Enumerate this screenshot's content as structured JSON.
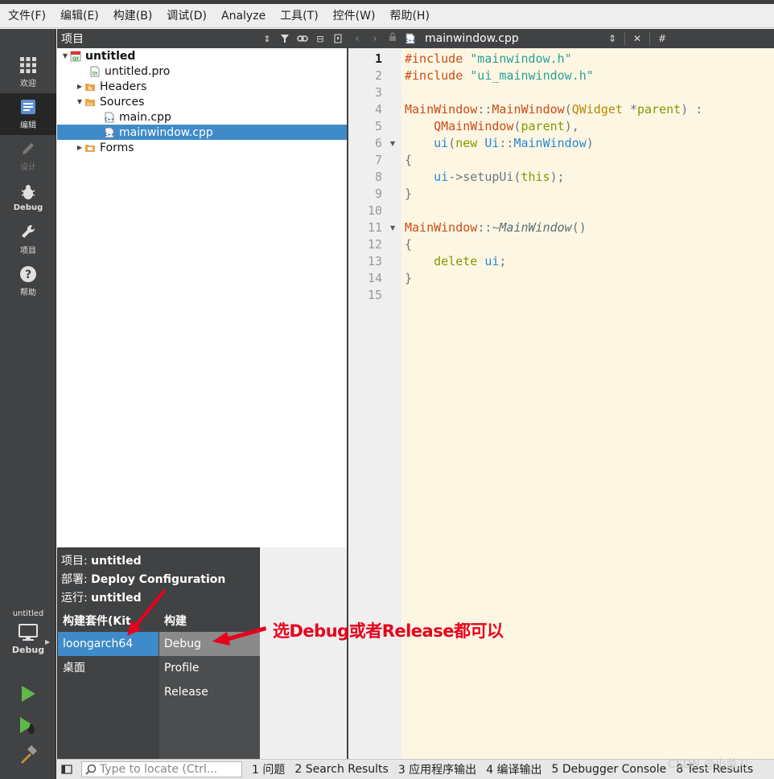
{
  "menubar": {
    "items": [
      "文件(F)",
      "编辑(E)",
      "构建(B)",
      "调试(D)",
      "Analyze",
      "工具(T)",
      "控件(W)",
      "帮助(H)"
    ]
  },
  "modes": [
    {
      "label": "欢迎",
      "icon": "welcome-grid-icon"
    },
    {
      "label": "编辑",
      "icon": "edit-document-icon",
      "active": true
    },
    {
      "label": "设计",
      "icon": "pencil-icon",
      "disabled": true
    },
    {
      "label": "Debug",
      "icon": "bug-icon"
    },
    {
      "label": "项目",
      "icon": "wrench-icon"
    },
    {
      "label": "帮助",
      "icon": "help-icon"
    }
  ],
  "kit_selector": {
    "project": "untitled",
    "build": "Debug"
  },
  "project_pane": {
    "title": "项目",
    "tree": [
      {
        "label": "untitled",
        "bold": true,
        "icon": "qt-project-icon"
      },
      {
        "label": "untitled.pro",
        "icon": "pro-file-icon"
      },
      {
        "label": "Headers",
        "icon": "header-folder-icon"
      },
      {
        "label": "Sources",
        "icon": "source-folder-icon"
      },
      {
        "label": "main.cpp",
        "icon": "cpp-file-icon"
      },
      {
        "label": "mainwindow.cpp",
        "icon": "cpp-file-icon",
        "selected": true
      },
      {
        "label": "Forms",
        "icon": "forms-folder-icon"
      }
    ]
  },
  "editor": {
    "filename": "mainwindow.cpp",
    "hash_label": "#",
    "line_numbers": [
      "1",
      "2",
      "3",
      "4",
      "5",
      "6",
      "7",
      "8",
      "9",
      "10",
      "11",
      "12",
      "13",
      "14",
      "15"
    ],
    "current_line": 1,
    "code": {
      "l1_pre": "#include",
      "l1_str": "\"mainwindow.h\"",
      "l2_pre": "#include",
      "l2_str": "\"ui_mainwindow.h\"",
      "l4_cls": "MainWindow",
      "l4_sep": "::",
      "l4_fn": "MainWindow",
      "l4_open": "(",
      "l4_type": "QWidget",
      "l4_star": " *",
      "l4_arg": "parent",
      "l4_close": ") :",
      "l5_fn": "QMainWindow",
      "l5_open": "(",
      "l5_arg": "parent",
      "l5_close": "),",
      "l6_var": "ui",
      "l6_open": "(",
      "l6_kw": "new",
      "l6_ns": "Ui",
      "l6_sep": "::",
      "l6_cls": "MainWindow",
      "l6_close": ")",
      "l7": "{",
      "l8_var": "ui",
      "l8_arrow": "->",
      "l8_fn": "setupUi",
      "l8_open": "(",
      "l8_kw": "this",
      "l8_close": ");",
      "l9": "}",
      "l11_cls": "MainWindow",
      "l11_sep": "::~",
      "l11_fn": "MainWindow",
      "l11_paren": "()",
      "l12": "{",
      "l13_kw": "delete",
      "l13_var": "ui",
      "l13_semi": ";",
      "l14": "}"
    }
  },
  "popup": {
    "project_label": "项目: ",
    "project_value": "untitled",
    "deploy_label": "部署: ",
    "deploy_value": "Deploy Configuration",
    "run_label": "运行: ",
    "run_value": "untitled",
    "kit_header": "构建套件(Kit",
    "build_header": "构建",
    "kits": [
      "loongarch64",
      "桌面"
    ],
    "builds": [
      "Debug",
      "Profile",
      "Release"
    ]
  },
  "annotation": {
    "text": "选Debug或者Release都可以",
    "color": "#e8001c"
  },
  "statusbar": {
    "locator_placeholder": "Type to locate (Ctrl...",
    "tabs": [
      "1  问题",
      "2  Search Results",
      "3  应用程序输出",
      "4  编译输出",
      "5  Debugger Console",
      "8  Test Results"
    ]
  },
  "watermark": "CSDN @小菜刀"
}
